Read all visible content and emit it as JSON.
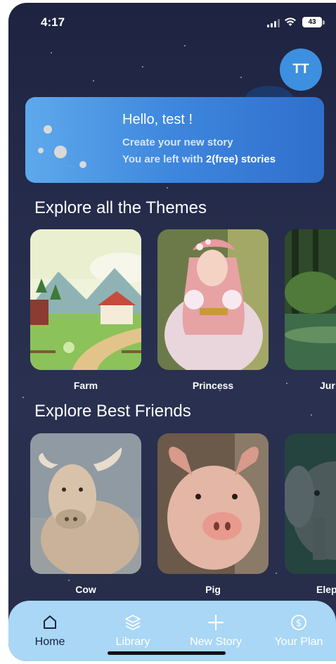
{
  "status_bar": {
    "time": "4:17",
    "battery": "43"
  },
  "user": {
    "initials": "TT"
  },
  "banner": {
    "greeting": "Hello,  test !",
    "subtitle": "Create your new story",
    "remaining_prefix": "You are left with ",
    "remaining_count": "2(free) stories"
  },
  "themes": {
    "title": "Explore all the Themes",
    "items": [
      {
        "label": "Farm"
      },
      {
        "label": "Princess"
      },
      {
        "label": "Jur"
      }
    ]
  },
  "friends": {
    "title": "Explore Best Friends",
    "items": [
      {
        "label": "Cow"
      },
      {
        "label": "Pig"
      },
      {
        "label": "Elep"
      }
    ]
  },
  "nav": {
    "items": [
      {
        "label": "Home",
        "icon": "home-icon",
        "active": true
      },
      {
        "label": "Library",
        "icon": "layers-icon",
        "active": false
      },
      {
        "label": "New Story",
        "icon": "plus-icon",
        "active": false
      },
      {
        "label": "Your Plan",
        "icon": "dollar-icon",
        "active": false
      }
    ]
  },
  "colors": {
    "accent": "#3e86dd",
    "nav_bg": "#a9d7f5",
    "background": "#252b4a"
  }
}
